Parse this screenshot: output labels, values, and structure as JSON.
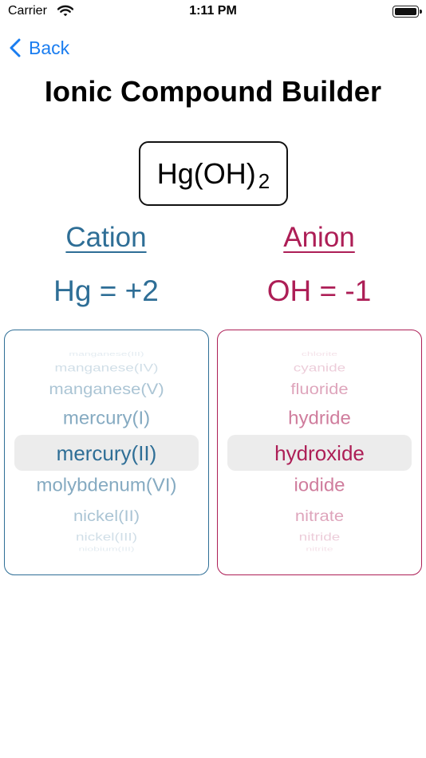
{
  "status_bar": {
    "carrier": "Carrier",
    "time": "1:11 PM"
  },
  "nav": {
    "back_label": "Back"
  },
  "title": "Ionic Compound Builder",
  "formula": {
    "main": "Hg(OH)",
    "subscript": "2"
  },
  "cation": {
    "header": "Cation",
    "charge_text": "Hg = +2",
    "options": [
      "manganese(III)",
      "manganese(IV)",
      "manganese(V)",
      "mercury(I)",
      "mercury(II)",
      "molybdenum(VI)",
      "nickel(II)",
      "nickel(III)",
      "niobium(III)"
    ],
    "selected_index": 4
  },
  "anion": {
    "header": "Anion",
    "charge_text": "OH = -1",
    "options": [
      "chlorite",
      "cyanide",
      "fluoride",
      "hydride",
      "hydroxide",
      "iodide",
      "nitrate",
      "nitride",
      "nitrite"
    ],
    "selected_index": 4
  },
  "colors": {
    "cation": "#2e6e96",
    "anion": "#ad1e56",
    "accent": "#1a7df0"
  }
}
